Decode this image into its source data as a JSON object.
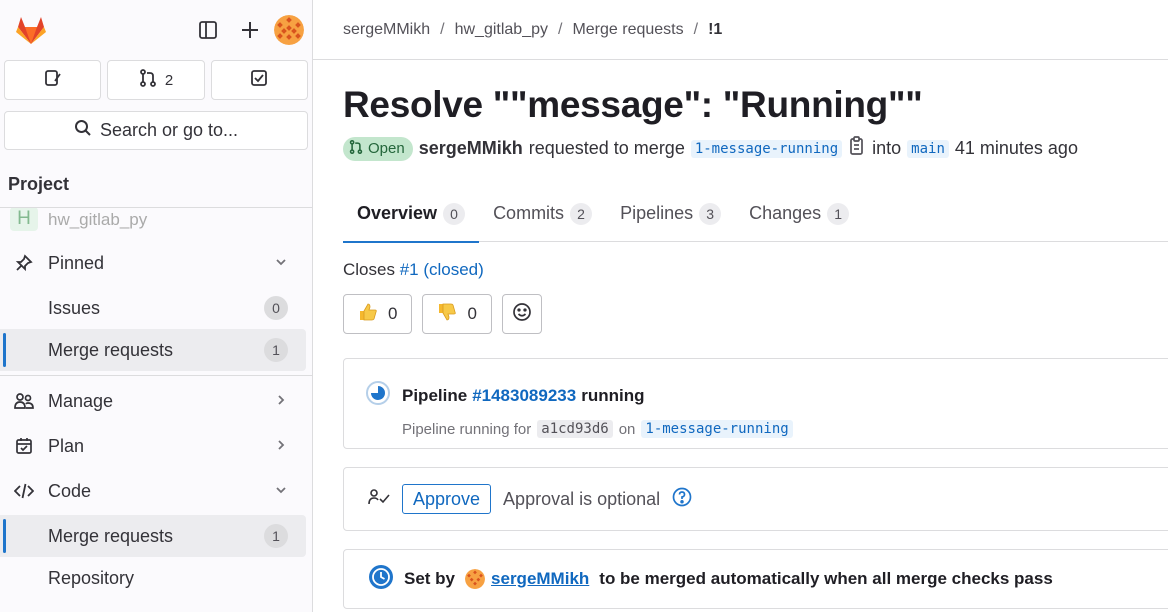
{
  "sidebar": {
    "quick": {
      "mr_count": "2"
    },
    "search_label": "Search or go to...",
    "section_title": "Project",
    "project": {
      "initial": "H",
      "name": "hw_gitlab_py"
    },
    "items": [
      {
        "label": "Pinned"
      },
      {
        "label": "Issues",
        "count": "0"
      },
      {
        "label": "Merge requests",
        "count": "1"
      },
      {
        "label": "Manage"
      },
      {
        "label": "Plan"
      },
      {
        "label": "Code"
      },
      {
        "label": "Merge requests",
        "count": "1"
      },
      {
        "label": "Repository"
      }
    ]
  },
  "breadcrumb": {
    "user": "sergeMMikh",
    "project": "hw_gitlab_py",
    "section": "Merge requests",
    "current": "!1"
  },
  "mr": {
    "title": "Resolve \"\"message\": \"Running\"\"",
    "status": "Open",
    "author": "sergeMMikh",
    "requested_text": "requested to merge",
    "source_branch": "1-message-running",
    "into_text": "into",
    "target_branch": "main",
    "time_ago": "41 minutes ago"
  },
  "tabs": [
    {
      "label": "Overview",
      "count": "0"
    },
    {
      "label": "Commits",
      "count": "2"
    },
    {
      "label": "Pipelines",
      "count": "3"
    },
    {
      "label": "Changes",
      "count": "1"
    }
  ],
  "closes": {
    "prefix": "Closes",
    "link": "#1 (closed)"
  },
  "reactions": {
    "thumbs_up": "0",
    "thumbs_down": "0"
  },
  "pipeline": {
    "prefix": "Pipeline",
    "id": "#1483089233",
    "status": "running",
    "sub_prefix": "Pipeline running for",
    "commit": "a1cd93d6",
    "on_text": "on",
    "branch": "1-message-running"
  },
  "approval": {
    "button": "Approve",
    "text": "Approval is optional"
  },
  "auto_merge": {
    "prefix": "Set by",
    "user": "sergeMMikh",
    "suffix": "to be merged automatically when all merge checks pass"
  },
  "colors": {
    "accent": "#1f75cb",
    "open_bg": "#c3e6cd",
    "open_fg": "#24663b",
    "logo": "#e24329"
  }
}
